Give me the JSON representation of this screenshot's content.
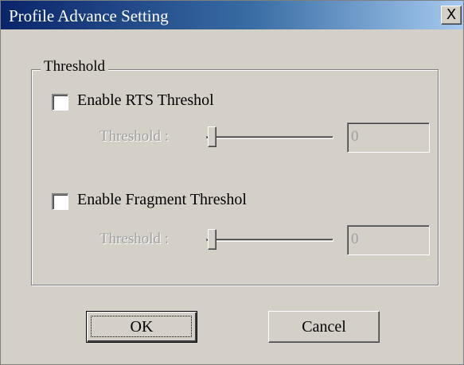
{
  "window": {
    "title": "Profile Advance Setting",
    "close_glyph": "X"
  },
  "group": {
    "legend": "Threshold"
  },
  "rts": {
    "checkbox_label": "Enable RTS Threshol",
    "checked": false,
    "slider_label": "Threshold :",
    "slider_value_fraction": 0,
    "value": "0"
  },
  "fragment": {
    "checkbox_label": "Enable Fragment Threshol",
    "checked": false,
    "slider_label": "Threshold :",
    "slider_value_fraction": 0,
    "value": "0"
  },
  "buttons": {
    "ok_label": "OK",
    "cancel_label": "Cancel"
  },
  "colors": {
    "dialog_bg": "#d4d0c8",
    "titlebar_start": "#0a246a",
    "titlebar_end": "#a6caf0",
    "disabled_text": "#a0a0a0"
  }
}
